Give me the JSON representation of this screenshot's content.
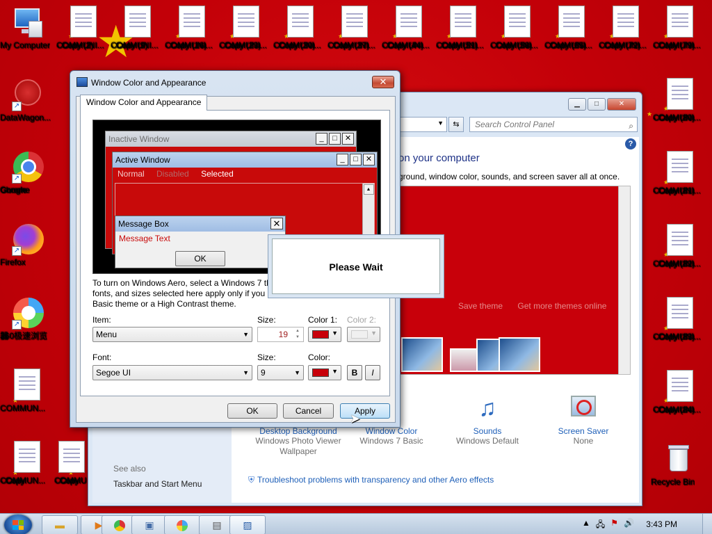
{
  "desktop": {
    "icons": [
      {
        "label": "My Computer"
      },
      {
        "label": "COMMUNI... - Copy (2)"
      },
      {
        "label": "COMMUNI... - Copy (9)"
      },
      {
        "label": "COMMUNI... - Copy (16)"
      },
      {
        "label": "COMMUNI... - Copy (23)"
      },
      {
        "label": "COMMUNI... - Copy (30)"
      },
      {
        "label": "COMMUNI... - Copy (37)"
      },
      {
        "label": "COMMUNI... - Copy (44)"
      },
      {
        "label": "COMMUNI... - Copy (51)"
      },
      {
        "label": "COMMUNI... - Copy (58)"
      },
      {
        "label": "COMMUNI... - Copy (65)"
      },
      {
        "label": "COMMUNI... - Copy (72)"
      },
      {
        "label": "COMMUNI... - Copy (79)"
      },
      {
        "label": "DataWagon..."
      },
      {
        "label": "Google Chrome"
      },
      {
        "label": "Firefox"
      },
      {
        "label": "360极速浏览器"
      },
      {
        "label": "COMMUN..."
      },
      {
        "label": "COMMUN... - Copy"
      },
      {
        "label": "COMMU... - Copy"
      },
      {
        "label": "COMMUNI... - Copy (80)"
      },
      {
        "label": "COMMUNI... - Copy (81)"
      },
      {
        "label": "COMMUNI... - Copy (82)"
      },
      {
        "label": "COMMUNI... - Copy (83)"
      },
      {
        "label": "COMMUNI... - Copy (84)"
      },
      {
        "label": "Recycle Bin"
      }
    ]
  },
  "control_panel": {
    "search_placeholder": "Search Control Panel",
    "heading": "on your computer",
    "subtitle": "ground, window color, sounds, and screen saver all at once.",
    "save_theme": "Save theme",
    "get_more_themes": "Get more themes online",
    "items": [
      {
        "title": "Desktop Background",
        "sub1": "Windows Photo Viewer",
        "sub2": "Wallpaper"
      },
      {
        "title": "Window Color",
        "sub1": "Windows 7 Basic",
        "sub2": ""
      },
      {
        "title": "Sounds",
        "sub1": "Windows Default",
        "sub2": ""
      },
      {
        "title": "Screen Saver",
        "sub1": "None",
        "sub2": ""
      }
    ],
    "see_also": "See also",
    "taskbar_link": "Taskbar and Start Menu",
    "troubleshoot": "Troubleshoot problems with transparency and other Aero effects"
  },
  "dialog": {
    "title": "Window Color and Appearance",
    "close_glyph": "✕",
    "tab": "Window Color and Appearance",
    "preview": {
      "inactive_title": "Inactive Window",
      "active_title": "Active Window",
      "menu_normal": "Normal",
      "menu_disabled": "Disabled",
      "menu_selected": "Selected",
      "msgbox_title": "Message Box",
      "msgbox_text": "Message Text",
      "ok": "OK"
    },
    "info_line1": "To turn on Windows Aero, select a Windows 7 th",
    "info_line2": "fonts, and sizes selected here apply only if you ha",
    "info_line3": "Basic theme or a High Contrast theme.",
    "item_label": "Item:",
    "item_value": "Menu",
    "size_label": "Size:",
    "size_value": "19",
    "color1_label": "Color 1:",
    "color2_label": "Color 2:",
    "font_label": "Font:",
    "font_value": "Segoe UI",
    "fontsize_label": "Size:",
    "fontsize_value": "9",
    "fontcolor_label": "Color:",
    "bold": "B",
    "italic": "I",
    "ok": "OK",
    "cancel": "Cancel",
    "apply": "Apply",
    "accent_color": "#c8000a"
  },
  "please_wait": {
    "text": "Please Wait"
  },
  "taskbar": {
    "clock": "3:43 PM"
  }
}
